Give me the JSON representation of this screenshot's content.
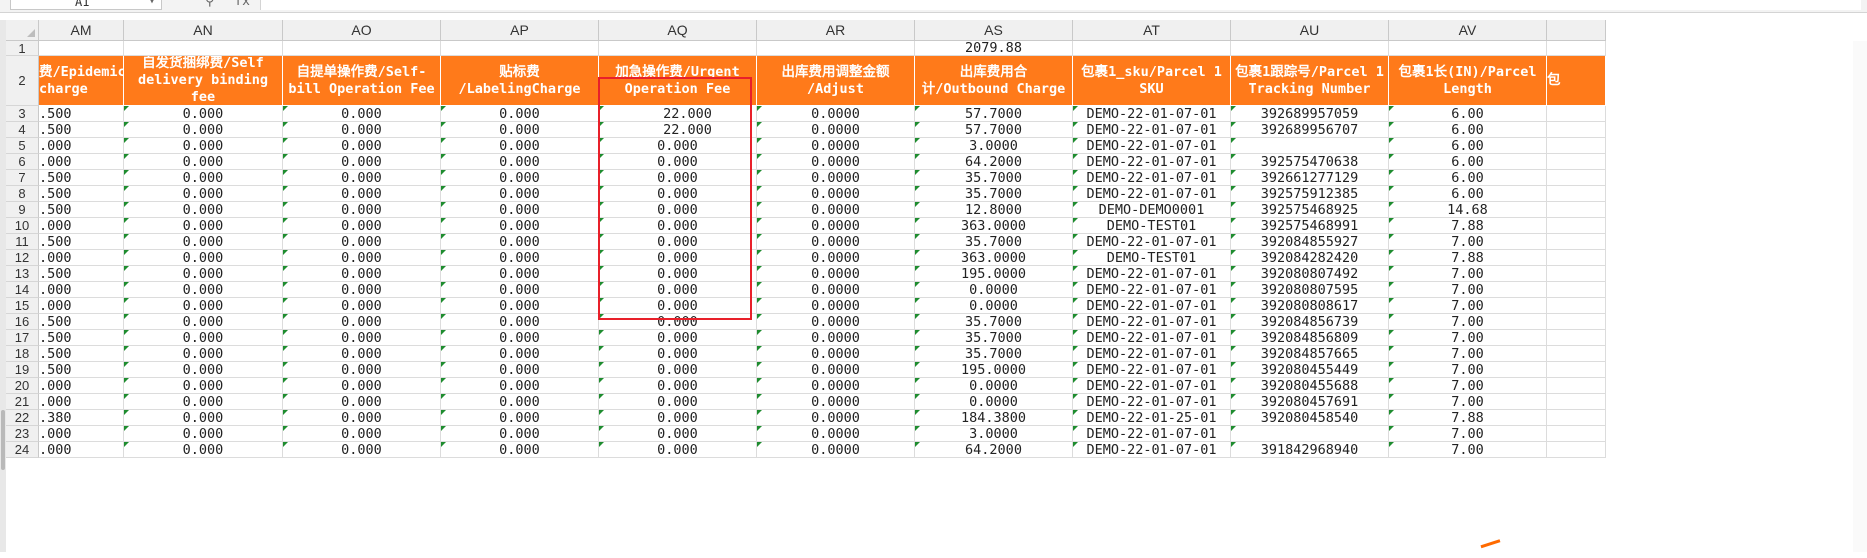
{
  "toolbar": {
    "name_box": "A1",
    "fx_label": "fx",
    "zoom_icon": "magnifier-icon"
  },
  "columns": [
    "AM",
    "AN",
    "AO",
    "AP",
    "AQ",
    "AR",
    "AS",
    "AT",
    "AU",
    "AV"
  ],
  "row1": [
    "",
    "",
    "",
    "",
    "",
    "",
    "2079.88",
    "",
    "",
    ""
  ],
  "headers": [
    "费/Epidemic charge",
    "自发货捆绑费/Self delivery binding fee",
    "自提单操作费/Self-bill Operation Fee",
    "贴标费 /LabelingCharge",
    "加急操作费/Urgent Operation Fee",
    "出库费用调整金额 /Adjust",
    "出库费用合计/Outbound Charge",
    "包裹1_sku/Parcel 1 SKU",
    "包裹1跟踪号/Parcel 1 Tracking Number",
    "包裹1长(IN)/Parcel Length"
  ],
  "partial_next_header": "包",
  "row_numbers": [
    1,
    2,
    3,
    4,
    5,
    6,
    7,
    8,
    9,
    10,
    11,
    12,
    13,
    14,
    15,
    16,
    17,
    18,
    19,
    20,
    21,
    22,
    23,
    24
  ],
  "rows": [
    [
      ".500",
      "0.000",
      "0.000",
      "0.000",
      "22.000",
      "0.0000",
      "57.7000",
      "DEMO-22-01-07-01",
      "392689957059",
      "6.00"
    ],
    [
      ".500",
      "0.000",
      "0.000",
      "0.000",
      "22.000",
      "0.0000",
      "57.7000",
      "DEMO-22-01-07-01",
      "392689956707",
      "6.00"
    ],
    [
      ".000",
      "0.000",
      "0.000",
      "0.000",
      "0.000",
      "0.0000",
      "3.0000",
      "DEMO-22-01-07-01",
      "",
      "6.00"
    ],
    [
      ".000",
      "0.000",
      "0.000",
      "0.000",
      "0.000",
      "0.0000",
      "64.2000",
      "DEMO-22-01-07-01",
      "392575470638",
      "6.00"
    ],
    [
      ".500",
      "0.000",
      "0.000",
      "0.000",
      "0.000",
      "0.0000",
      "35.7000",
      "DEMO-22-01-07-01",
      "392661277129",
      "6.00"
    ],
    [
      ".500",
      "0.000",
      "0.000",
      "0.000",
      "0.000",
      "0.0000",
      "35.7000",
      "DEMO-22-01-07-01",
      "392575912385",
      "6.00"
    ],
    [
      ".500",
      "0.000",
      "0.000",
      "0.000",
      "0.000",
      "0.0000",
      "12.8000",
      "DEMO-DEMO0001",
      "392575468925",
      "14.68"
    ],
    [
      ".000",
      "0.000",
      "0.000",
      "0.000",
      "0.000",
      "0.0000",
      "363.0000",
      "DEMO-TEST01",
      "392575468991",
      "7.88"
    ],
    [
      ".500",
      "0.000",
      "0.000",
      "0.000",
      "0.000",
      "0.0000",
      "35.7000",
      "DEMO-22-01-07-01",
      "392084855927",
      "7.00"
    ],
    [
      ".000",
      "0.000",
      "0.000",
      "0.000",
      "0.000",
      "0.0000",
      "363.0000",
      "DEMO-TEST01",
      "392084282420",
      "7.88"
    ],
    [
      ".500",
      "0.000",
      "0.000",
      "0.000",
      "0.000",
      "0.0000",
      "195.0000",
      "DEMO-22-01-07-01",
      "392080807492",
      "7.00"
    ],
    [
      ".000",
      "0.000",
      "0.000",
      "0.000",
      "0.000",
      "0.0000",
      "0.0000",
      "DEMO-22-01-07-01",
      "392080807595",
      "7.00"
    ],
    [
      ".000",
      "0.000",
      "0.000",
      "0.000",
      "0.000",
      "0.0000",
      "0.0000",
      "DEMO-22-01-07-01",
      "392080808617",
      "7.00"
    ],
    [
      ".500",
      "0.000",
      "0.000",
      "0.000",
      "0.000",
      "0.0000",
      "35.7000",
      "DEMO-22-01-07-01",
      "392084856739",
      "7.00"
    ],
    [
      ".500",
      "0.000",
      "0.000",
      "0.000",
      "0.000",
      "0.0000",
      "35.7000",
      "DEMO-22-01-07-01",
      "392084856809",
      "7.00"
    ],
    [
      ".500",
      "0.000",
      "0.000",
      "0.000",
      "0.000",
      "0.0000",
      "35.7000",
      "DEMO-22-01-07-01",
      "392084857665",
      "7.00"
    ],
    [
      ".500",
      "0.000",
      "0.000",
      "0.000",
      "0.000",
      "0.0000",
      "195.0000",
      "DEMO-22-01-07-01",
      "392080455449",
      "7.00"
    ],
    [
      ".000",
      "0.000",
      "0.000",
      "0.000",
      "0.000",
      "0.0000",
      "0.0000",
      "DEMO-22-01-07-01",
      "392080455688",
      "7.00"
    ],
    [
      ".000",
      "0.000",
      "0.000",
      "0.000",
      "0.000",
      "0.0000",
      "0.0000",
      "DEMO-22-01-07-01",
      "392080457691",
      "7.00"
    ],
    [
      ".380",
      "0.000",
      "0.000",
      "0.000",
      "0.000",
      "0.0000",
      "184.3800",
      "DEMO-22-01-25-01",
      "392080458540",
      "7.88"
    ],
    [
      ".000",
      "0.000",
      "0.000",
      "0.000",
      "0.000",
      "0.0000",
      "3.0000",
      "DEMO-22-01-07-01",
      "",
      "7.00"
    ],
    [
      ".000",
      "0.000",
      "0.000",
      "0.000",
      "0.000",
      "0.0000",
      "64.2000",
      "DEMO-22-01-07-01",
      "391842968940",
      "7.00"
    ]
  ],
  "colors": {
    "header_bg": "#ff7a1a",
    "highlight_border": "#e8202a"
  }
}
